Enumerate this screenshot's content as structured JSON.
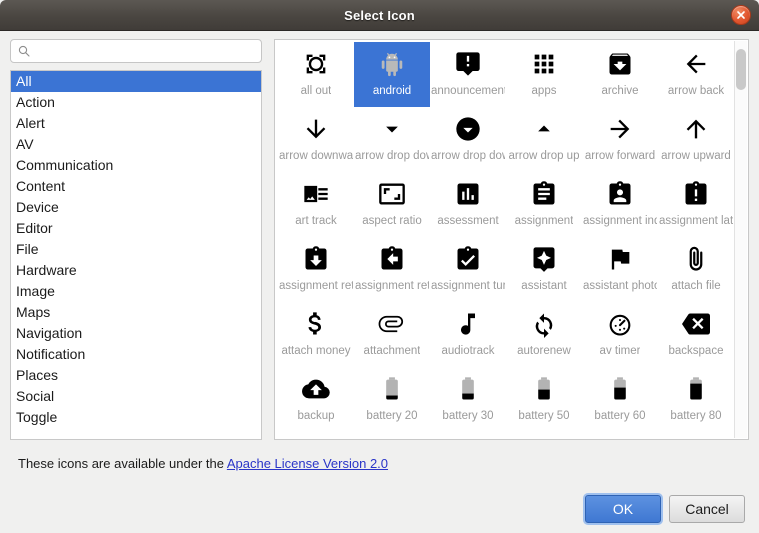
{
  "window": {
    "title": "Select Icon",
    "close_icon": "close-icon"
  },
  "search": {
    "value": "",
    "placeholder": "",
    "icon": "search-icon"
  },
  "categories": {
    "selected": "All",
    "items": [
      "All",
      "Action",
      "Alert",
      "AV",
      "Communication",
      "Content",
      "Device",
      "Editor",
      "File",
      "Hardware",
      "Image",
      "Maps",
      "Navigation",
      "Notification",
      "Places",
      "Social",
      "Toggle"
    ]
  },
  "grid": {
    "selected": "android",
    "scrollbar": {
      "thumb_top_pct": 2,
      "thumb_height_pct": 10
    },
    "icons": [
      {
        "label": "all out",
        "icon": "all-out-icon"
      },
      {
        "label": "android",
        "icon": "android-icon"
      },
      {
        "label": "announcement",
        "icon": "announcement-icon"
      },
      {
        "label": "apps",
        "icon": "apps-icon"
      },
      {
        "label": "archive",
        "icon": "archive-icon"
      },
      {
        "label": "arrow back",
        "icon": "arrow-back-icon"
      },
      {
        "label": "arrow downward",
        "icon": "arrow-downward-icon"
      },
      {
        "label": "arrow drop down",
        "icon": "arrow-drop-down-icon"
      },
      {
        "label": "arrow drop down circle",
        "icon": "arrow-drop-down-circle-icon"
      },
      {
        "label": "arrow drop up",
        "icon": "arrow-drop-up-icon"
      },
      {
        "label": "arrow forward",
        "icon": "arrow-forward-icon"
      },
      {
        "label": "arrow upward",
        "icon": "arrow-upward-icon"
      },
      {
        "label": "art track",
        "icon": "art-track-icon"
      },
      {
        "label": "aspect ratio",
        "icon": "aspect-ratio-icon"
      },
      {
        "label": "assessment",
        "icon": "assessment-icon"
      },
      {
        "label": "assignment",
        "icon": "assignment-icon"
      },
      {
        "label": "assignment ind",
        "icon": "assignment-ind-icon"
      },
      {
        "label": "assignment late",
        "icon": "assignment-late-icon"
      },
      {
        "label": "assignment returned",
        "icon": "assignment-returned-icon"
      },
      {
        "label": "assignment return",
        "icon": "assignment-return-icon"
      },
      {
        "label": "assignment turned in",
        "icon": "assignment-turned-in-icon"
      },
      {
        "label": "assistant",
        "icon": "assistant-icon"
      },
      {
        "label": "assistant photo",
        "icon": "assistant-photo-icon"
      },
      {
        "label": "attach file",
        "icon": "attach-file-icon"
      },
      {
        "label": "attach money",
        "icon": "attach-money-icon"
      },
      {
        "label": "attachment",
        "icon": "attachment-icon"
      },
      {
        "label": "audiotrack",
        "icon": "audiotrack-icon"
      },
      {
        "label": "autorenew",
        "icon": "autorenew-icon"
      },
      {
        "label": "av timer",
        "icon": "av-timer-icon"
      },
      {
        "label": "backspace",
        "icon": "backspace-icon"
      },
      {
        "label": "backup",
        "icon": "backup-icon"
      },
      {
        "label": "battery 20",
        "icon": "battery-20-icon"
      },
      {
        "label": "battery 30",
        "icon": "battery-30-icon"
      },
      {
        "label": "battery 50",
        "icon": "battery-50-icon"
      },
      {
        "label": "battery 60",
        "icon": "battery-60-icon"
      },
      {
        "label": "battery 80",
        "icon": "battery-80-icon"
      },
      {
        "label": "",
        "icon": "battery-90-icon"
      },
      {
        "label": "",
        "icon": "battery-full-icon"
      },
      {
        "label": "",
        "icon": "battery-alert-icon"
      },
      {
        "label": "",
        "icon": "battery-charging-20-icon"
      },
      {
        "label": "",
        "icon": "battery-charging-30-icon"
      },
      {
        "label": "",
        "icon": "battery-charging-50-icon"
      }
    ]
  },
  "license": {
    "text": "These icons are available under the ",
    "link_text": "Apache License Version 2.0"
  },
  "footer": {
    "ok_label": "OK",
    "cancel_label": "Cancel"
  },
  "colors": {
    "selection_blue": "#3b74d4",
    "titlebar_dark": "#4a4641",
    "link_blue": "#2a35c8",
    "close_red": "#e2562f"
  }
}
